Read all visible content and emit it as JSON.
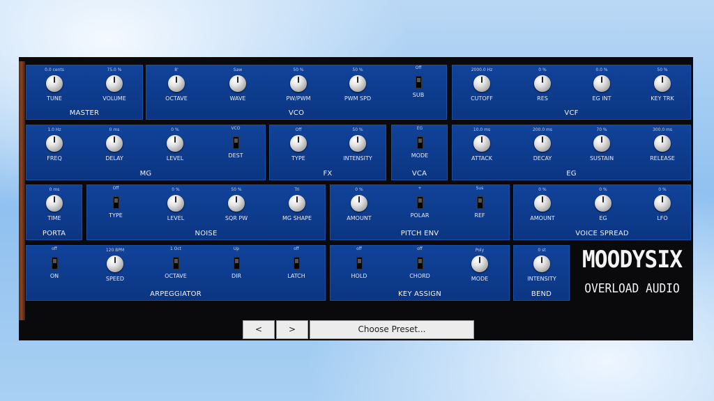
{
  "brand": {
    "title": "MOODYSIX",
    "subtitle": "OVERLOAD AUDIO"
  },
  "sections": {
    "master": "MASTER",
    "vco": "VCO",
    "vcf": "VCF",
    "mg": "MG",
    "fx": "FX",
    "vca": "VCA",
    "eg": "EG",
    "porta": "PORTA",
    "noise": "NOISE",
    "pitch_env": "PITCH ENV",
    "voice_spread": "VOICE SPREAD",
    "arpeggiator": "ARPEGGIATOR",
    "key_assign": "KEY ASSIGN",
    "bend": "BEND"
  },
  "controls": {
    "master_tune": {
      "label": "TUNE",
      "value": "0.0 cents",
      "kind": "knob"
    },
    "master_volume": {
      "label": "VOLUME",
      "value": "75.0 %",
      "kind": "knob"
    },
    "vco_octave": {
      "label": "OCTAVE",
      "value": "8'",
      "kind": "knob"
    },
    "vco_wave": {
      "label": "WAVE",
      "value": "Saw",
      "kind": "knob"
    },
    "vco_pwpwm": {
      "label": "PW/PWM",
      "value": "50 %",
      "kind": "knob"
    },
    "vco_pwmspd": {
      "label": "PWM SPD",
      "value": "50 %",
      "kind": "knob"
    },
    "vco_sub": {
      "label": "SUB",
      "value": "Off",
      "kind": "switch"
    },
    "vcf_cutoff": {
      "label": "CUTOFF",
      "value": "2000.0 Hz",
      "kind": "knob"
    },
    "vcf_res": {
      "label": "RES",
      "value": "0 %",
      "kind": "knob"
    },
    "vcf_egint": {
      "label": "EG INT",
      "value": "0.0 %",
      "kind": "knob"
    },
    "vcf_keytrk": {
      "label": "KEY TRK",
      "value": "50 %",
      "kind": "knob"
    },
    "mg_freq": {
      "label": "FREQ",
      "value": "1.0 Hz",
      "kind": "knob"
    },
    "mg_delay": {
      "label": "DELAY",
      "value": "0 ms",
      "kind": "knob"
    },
    "mg_level": {
      "label": "LEVEL",
      "value": "0 %",
      "kind": "knob"
    },
    "mg_dest": {
      "label": "DEST",
      "value": "VCO",
      "kind": "switch"
    },
    "fx_type": {
      "label": "TYPE",
      "value": "Off",
      "kind": "knob"
    },
    "fx_intensity": {
      "label": "INTENSITY",
      "value": "50 %",
      "kind": "knob"
    },
    "vca_mode": {
      "label": "MODE",
      "value": "EG",
      "kind": "switch"
    },
    "eg_attack": {
      "label": "ATTACK",
      "value": "10.0 ms",
      "kind": "knob"
    },
    "eg_decay": {
      "label": "DECAY",
      "value": "200.0 ms",
      "kind": "knob"
    },
    "eg_sustain": {
      "label": "SUSTAIN",
      "value": "70 %",
      "kind": "knob"
    },
    "eg_release": {
      "label": "RELEASE",
      "value": "300.0 ms",
      "kind": "knob"
    },
    "porta_time": {
      "label": "TIME",
      "value": "0 ms",
      "kind": "knob"
    },
    "noise_type": {
      "label": "TYPE",
      "value": "Off",
      "kind": "switch"
    },
    "noise_level": {
      "label": "LEVEL",
      "value": "0 %",
      "kind": "knob"
    },
    "noise_sqrpw": {
      "label": "SQR PW",
      "value": "50 %",
      "kind": "knob"
    },
    "noise_mgshape": {
      "label": "MG SHAPE",
      "value": "Tri",
      "kind": "knob"
    },
    "penv_amount": {
      "label": "AMOUNT",
      "value": "0 %",
      "kind": "knob"
    },
    "penv_polar": {
      "label": "POLAR",
      "value": "+",
      "kind": "switch"
    },
    "penv_ref": {
      "label": "REF",
      "value": "Sus",
      "kind": "switch"
    },
    "vs_amount": {
      "label": "AMOUNT",
      "value": "0 %",
      "kind": "knob"
    },
    "vs_eg": {
      "label": "EG",
      "value": "0 %",
      "kind": "knob"
    },
    "vs_lfo": {
      "label": "LFO",
      "value": "0 %",
      "kind": "knob"
    },
    "arp_on": {
      "label": "ON",
      "value": "off",
      "kind": "switch"
    },
    "arp_speed": {
      "label": "SPEED",
      "value": "120 BPM",
      "kind": "knob"
    },
    "arp_octave": {
      "label": "OCTAVE",
      "value": "1 Oct",
      "kind": "switch"
    },
    "arp_dir": {
      "label": "DIR",
      "value": "Up",
      "kind": "switch"
    },
    "arp_latch": {
      "label": "LATCH",
      "value": "off",
      "kind": "switch"
    },
    "ka_hold": {
      "label": "HOLD",
      "value": "off",
      "kind": "switch"
    },
    "ka_chord": {
      "label": "CHORD",
      "value": "off",
      "kind": "switch"
    },
    "ka_mode": {
      "label": "MODE",
      "value": "Poly",
      "kind": "knob"
    },
    "bend_intensity": {
      "label": "INTENSITY",
      "value": "0 st",
      "kind": "knob"
    }
  },
  "preset_bar": {
    "prev": "<",
    "next": ">",
    "choose": "Choose Preset..."
  }
}
